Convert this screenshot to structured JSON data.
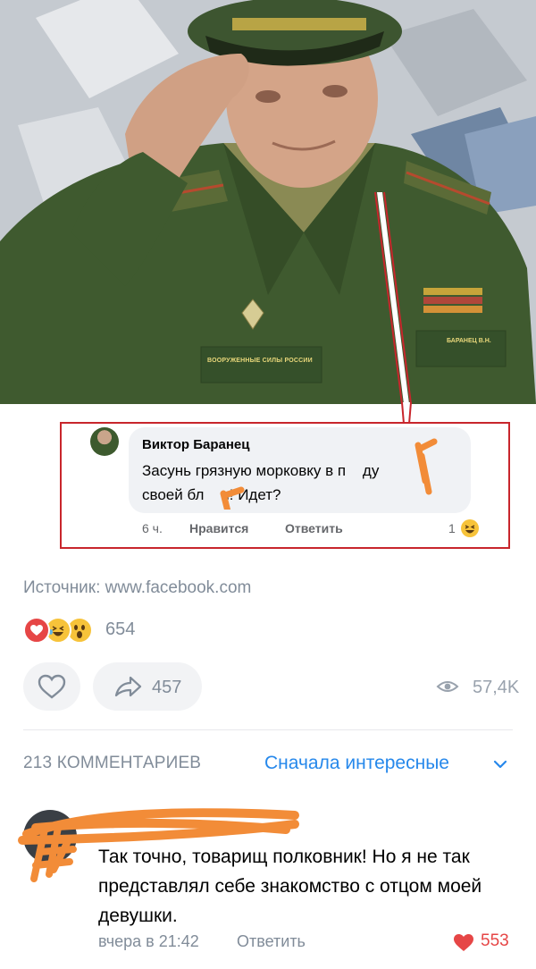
{
  "photo": {
    "patch_text": "ВООРУЖЕННЫЕ СИЛЫ РОССИИ",
    "name_tag": "БАРАНЕЦ В.Н."
  },
  "fb_comment": {
    "author": "Виктор Баранец",
    "text_line1": "Засунь грязную морковку в п    ду",
    "text_line2": "своей бл    и! Идет?",
    "time": "6 ч.",
    "like_label": "Нравится",
    "reply_label": "Ответить",
    "reaction_count": "1",
    "reaction_icon": "laughing-emoji-icon",
    "colors": {
      "callout_border": "#c8262c",
      "scribble": "#f28c38"
    }
  },
  "post": {
    "source": "Источник: www.facebook.com",
    "reactions": [
      "heart-icon",
      "laughing-emoji-icon",
      "wow-emoji-icon"
    ],
    "reactions_count": "654",
    "shares_count": "457",
    "views_count": "57,4K"
  },
  "comments": {
    "count_label": "213 КОММЕНТАРИЕВ",
    "sort_label": "Сначала интересные",
    "top_comment": {
      "text": "Так точно, товарищ полковник! Но я не так представлял себе знакомство с отцом моей девушки.",
      "time": "вчера в 21:42",
      "reply_label": "Ответить",
      "likes": "553"
    }
  },
  "colors": {
    "vk_blue": "#2688eb",
    "vk_secondary": "#818c99",
    "like_red": "#e64646"
  }
}
